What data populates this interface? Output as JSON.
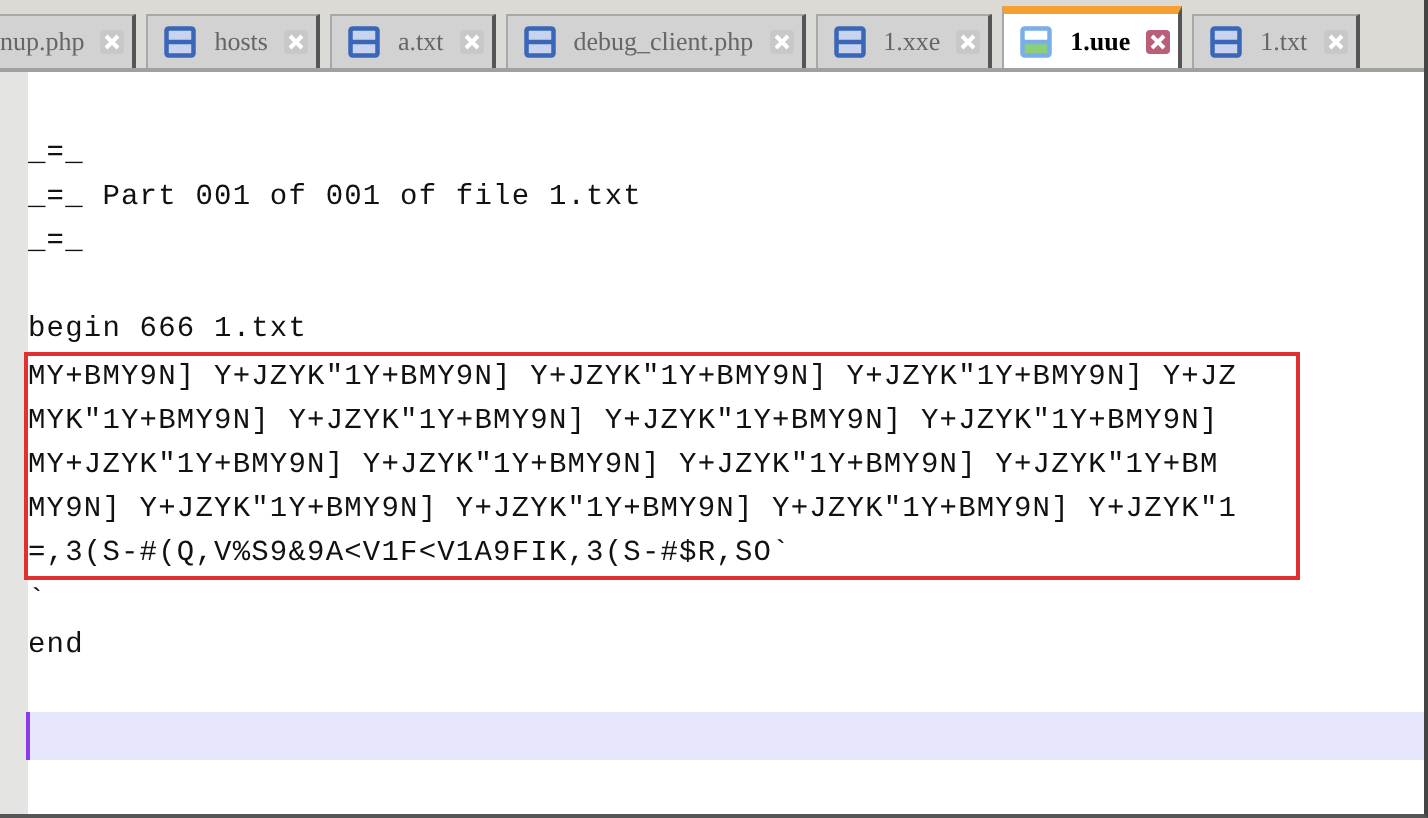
{
  "tabs": [
    {
      "label": "nup.php",
      "selected": false,
      "icon": false
    },
    {
      "label": "hosts",
      "selected": false,
      "icon": true
    },
    {
      "label": "a.txt",
      "selected": false,
      "icon": true
    },
    {
      "label": "debug_client.php",
      "selected": false,
      "icon": true
    },
    {
      "label": "1.xxe",
      "selected": false,
      "icon": true
    },
    {
      "label": "1.uue",
      "selected": true,
      "icon": true
    },
    {
      "label": "1.txt",
      "selected": false,
      "icon": true
    }
  ],
  "editor": {
    "blocks": [
      {
        "kind": "plain",
        "lines": [
          "_=_",
          "_=_ Part 001 of 001 of file 1.txt",
          "_=_"
        ]
      },
      {
        "kind": "blank"
      },
      {
        "kind": "plain",
        "lines": [
          "begin 666 1.txt"
        ]
      },
      {
        "kind": "boxed",
        "lines": [
          "MY+BMY9N] Y+JZYK\"1Y+BMY9N] Y+JZYK\"1Y+BMY9N] Y+JZYK\"1Y+BMY9N] Y+JZ",
          "MYK\"1Y+BMY9N] Y+JZYK\"1Y+BMY9N] Y+JZYK\"1Y+BMY9N] Y+JZYK\"1Y+BMY9N]",
          "MY+JZYK\"1Y+BMY9N] Y+JZYK\"1Y+BMY9N] Y+JZYK\"1Y+BMY9N] Y+JZYK\"1Y+BM",
          "MY9N] Y+JZYK\"1Y+BMY9N] Y+JZYK\"1Y+BMY9N] Y+JZYK\"1Y+BMY9N] Y+JZYK\"1",
          "=,3(S-#(Q,V%S9&9A<V1F<V1A9FIK,3(S-#$R,SO`"
        ]
      },
      {
        "kind": "plain",
        "lines": [
          "`"
        ]
      },
      {
        "kind": "plain",
        "lines": [
          "end"
        ]
      },
      {
        "kind": "blank"
      },
      {
        "kind": "cursor"
      }
    ]
  }
}
